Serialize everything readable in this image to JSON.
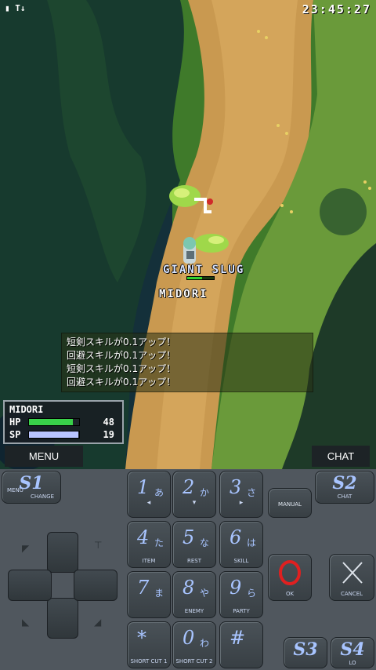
{
  "status": {
    "left_icons": "▮ T↓",
    "clock": "23:45:27"
  },
  "enemy": {
    "name": "GIANT SLUG",
    "hp_fraction": 0.55
  },
  "player": {
    "name": "MIDORI"
  },
  "log": [
    "短剣スキルが0.1アップ！",
    "回避スキルが0.1アップ！",
    "短剣スキルが0.1アップ！",
    "回避スキルが0.1アップ！"
  ],
  "stats": {
    "name": "MIDORI",
    "hp_label": "HP",
    "hp_value": "48",
    "hp_fraction": 0.88,
    "sp_label": "SP",
    "sp_value": "19",
    "sp_fraction": 0.98
  },
  "softkeys": {
    "menu": "MENU",
    "chat": "CHAT"
  },
  "keypad": {
    "s1": {
      "big": "S1",
      "small1": "MENU",
      "small2": "CHANGE"
    },
    "s2": {
      "big": "S2",
      "small": "CHAT"
    },
    "s3": {
      "big": "S3"
    },
    "s4": {
      "big": "S4",
      "small": "LO"
    },
    "manual": "MANUAL",
    "ok": "OK",
    "cancel": "CANCEL",
    "keys": [
      {
        "digit": "1",
        "kana": "あ",
        "sub": "",
        "glyph": "◂"
      },
      {
        "digit": "2",
        "kana": "か",
        "sub": "",
        "glyph": "▾"
      },
      {
        "digit": "3",
        "kana": "さ",
        "sub": "",
        "glyph": "▸"
      },
      {
        "digit": "4",
        "kana": "た",
        "sub": "ITEM",
        "glyph": ""
      },
      {
        "digit": "5",
        "kana": "な",
        "sub": "REST",
        "glyph": ""
      },
      {
        "digit": "6",
        "kana": "は",
        "sub": "SKILL",
        "glyph": ""
      },
      {
        "digit": "7",
        "kana": "ま",
        "sub": "",
        "glyph": ""
      },
      {
        "digit": "8",
        "kana": "や",
        "sub": "ENEMY",
        "glyph": ""
      },
      {
        "digit": "9",
        "kana": "ら",
        "sub": "PARTY",
        "glyph": ""
      },
      {
        "digit": "*",
        "kana": "",
        "sub": "SHORT CUT 1",
        "glyph": ""
      },
      {
        "digit": "0",
        "kana": "わ",
        "sub": "SHORT CUT 2",
        "glyph": ""
      },
      {
        "digit": "#",
        "kana": "",
        "sub": "",
        "glyph": ""
      }
    ]
  }
}
